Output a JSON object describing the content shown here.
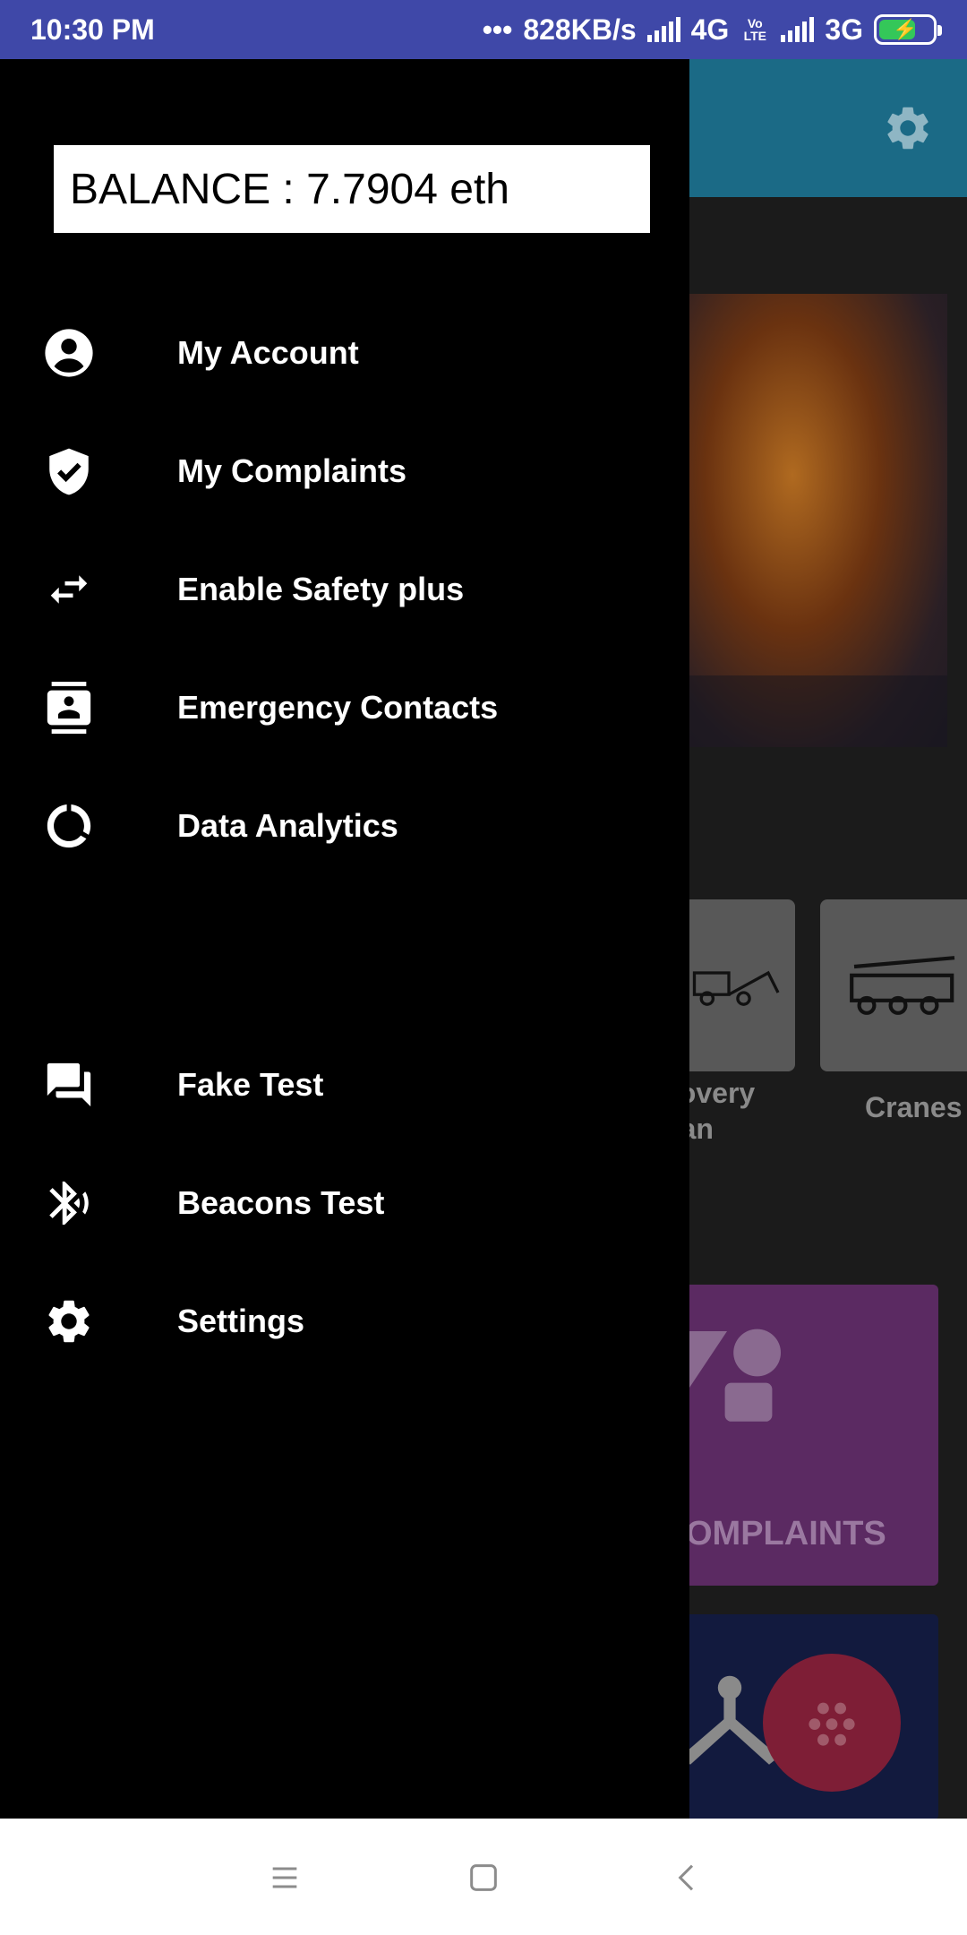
{
  "status_bar": {
    "time": "10:30 PM",
    "dots": "•••",
    "speed": "828KB/s",
    "network1": "4G",
    "volte": "Vo LTE",
    "network2": "3G",
    "battery_icon": "battery-charging-icon"
  },
  "drawer": {
    "balance": "BALANCE : 7.7904 eth",
    "items": [
      {
        "label": "My Account",
        "icon": "account-circle-icon"
      },
      {
        "label": "My Complaints",
        "icon": "verified-shield-icon"
      },
      {
        "label": "Enable Safety plus",
        "icon": "swap-horizontal-icon"
      },
      {
        "label": "Emergency Contacts",
        "icon": "contacts-icon"
      },
      {
        "label": "Data Analytics",
        "icon": "donut-chart-icon"
      },
      {
        "label": "Fake Test",
        "icon": "forum-icon"
      },
      {
        "label": "Beacons Test",
        "icon": "bluetooth-searching-icon"
      },
      {
        "label": "Settings",
        "icon": "gear-icon"
      }
    ]
  },
  "background": {
    "service_cards": [
      {
        "label": "covery\nVan"
      },
      {
        "label": "Cranes"
      }
    ],
    "complaints_label": "OMPLAINTS"
  },
  "colors": {
    "status_bar": "#3f48a8",
    "toolbar": "#1b6a86",
    "drawer": "#000000",
    "complaints_tile": "#5b2a62",
    "fab": "#7e1e36"
  },
  "nav_bar": {
    "menu_icon": "menu-icon",
    "home_icon": "home-square-icon",
    "back_icon": "back-chevron-icon"
  }
}
